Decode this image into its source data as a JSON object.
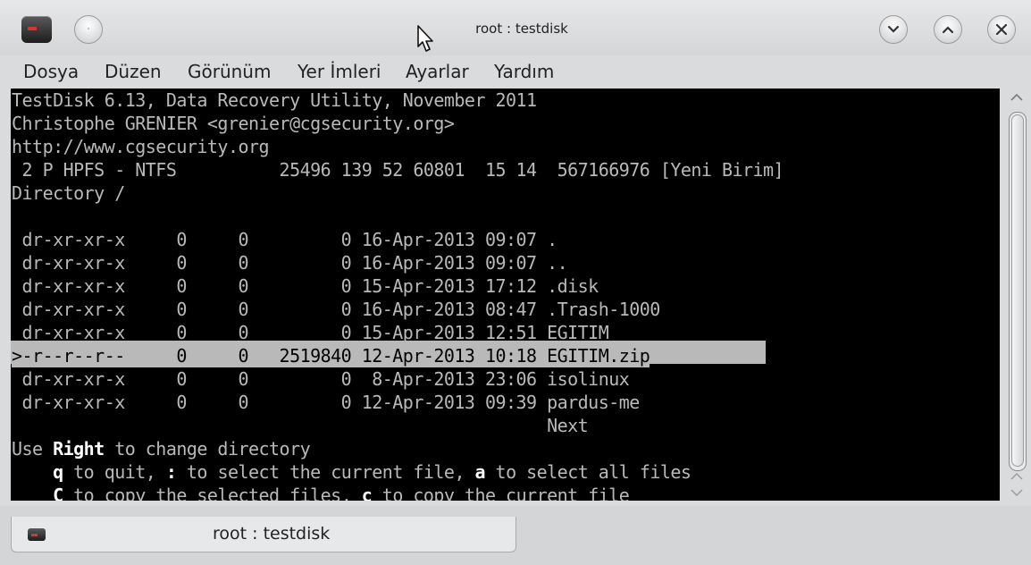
{
  "window": {
    "title": "root : testdisk",
    "menu_button_symbol": "·",
    "minimize_symbol": "⌄",
    "maximize_symbol": "⌃",
    "close_symbol": "✕"
  },
  "menubar": {
    "items": [
      "Dosya",
      "Düzen",
      "Görünüm",
      "Yer İmleri",
      "Ayarlar",
      "Yardım"
    ]
  },
  "terminal": {
    "lines": [
      "TestDisk 6.13, Data Recovery Utility, November 2011",
      "Christophe GRENIER <grenier@cgsecurity.org>",
      "http://www.cgsecurity.org",
      " 2 P HPFS - NTFS          25496 139 52 60801  15 14  567166976 [Yeni Birim]",
      "Directory /",
      "",
      " dr-xr-xr-x     0     0         0 16-Apr-2013 09:07 .",
      " dr-xr-xr-x     0     0         0 16-Apr-2013 09:07 ..",
      " dr-xr-xr-x     0     0         0 15-Apr-2013 17:12 .disk",
      " dr-xr-xr-x     0     0         0 16-Apr-2013 08:47 .Trash-1000",
      " dr-xr-xr-x     0     0         0 15-Apr-2013 12:51 EGITIM",
      ">-r--r--r--     0     0   2519840 12-Apr-2013 10:18 EGITIM.zip",
      " dr-xr-xr-x     0     0         0  8-Apr-2013 23:06 isolinux",
      " dr-xr-xr-x     0     0         0 12-Apr-2013 09:39 pardus-me",
      "                                                    Next"
    ],
    "help": {
      "line1_pre": "Use ",
      "line1_key": "Right",
      "line1_post": " to change directory",
      "line2_pre": "    ",
      "line2_key1": "q",
      "line2_mid1": " to quit, ",
      "line2_key2": ":",
      "line2_mid2": " to select the current file, ",
      "line2_key3": "a",
      "line2_post": " to select all files",
      "line3_pre": "    ",
      "line3_key1": "C",
      "line3_mid": " to copy the selected files, ",
      "line3_key2": "c",
      "line3_post": " to copy the current file"
    }
  },
  "tabbar": {
    "active_tab_label": "root : testdisk"
  }
}
